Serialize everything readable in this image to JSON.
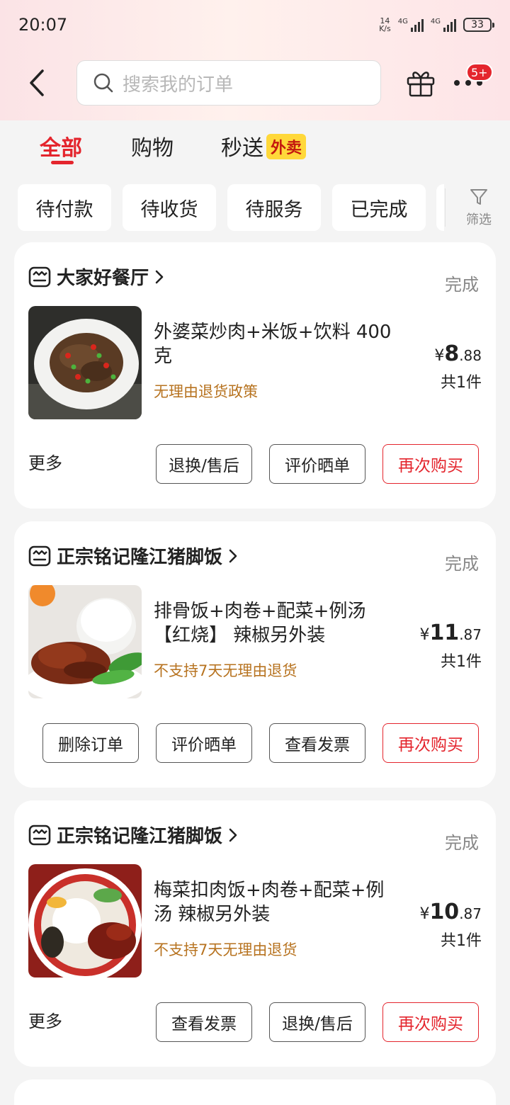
{
  "status_bar": {
    "time": "20:07",
    "net_speed_value": "14",
    "net_speed_unit": "K/s",
    "network_1": "4G",
    "network_2": "4G",
    "battery": "33"
  },
  "header": {
    "search_placeholder": "搜索我的订单",
    "notification_badge": "5+"
  },
  "tabs": [
    {
      "label": "全部",
      "active": true
    },
    {
      "label": "购物",
      "active": false
    },
    {
      "label": "秒送",
      "tag": "外卖",
      "active": false
    }
  ],
  "filters": {
    "chips": [
      "待付款",
      "待收货",
      "待服务",
      "已完成"
    ],
    "filter_label": "筛选"
  },
  "orders": [
    {
      "store": "大家好餐厅",
      "status": "完成",
      "title": "外婆菜炒肉+米饭+饮料 400克",
      "policy": "无理由退货政策",
      "price_symbol": "¥",
      "price_int": "8",
      "price_dec": ".88",
      "quantity": "共1件",
      "more": "更多",
      "buttons": [
        "退换/售后",
        "评价晒单",
        "再次购买"
      ]
    },
    {
      "store": "正宗铭记隆江猪脚饭",
      "status": "完成",
      "title": "排骨饭+肉卷+配菜+例汤【红烧】 辣椒另外装",
      "policy": "不支持7天无理由退货",
      "price_symbol": "¥",
      "price_int": "11",
      "price_dec": ".87",
      "quantity": "共1件",
      "buttons": [
        "删除订单",
        "评价晒单",
        "查看发票",
        "再次购买"
      ]
    },
    {
      "store": "正宗铭记隆江猪脚饭",
      "status": "完成",
      "title": "梅菜扣肉饭+肉卷+配菜+例汤 辣椒另外装",
      "policy": "不支持7天无理由退货",
      "price_symbol": "¥",
      "price_int": "10",
      "price_dec": ".87",
      "quantity": "共1件",
      "more": "更多",
      "buttons": [
        "查看发票",
        "退换/售后",
        "再次购买"
      ]
    }
  ],
  "colors": {
    "accent": "#e4252d",
    "policy": "#b77320",
    "tag_bg": "#ffd83a"
  }
}
